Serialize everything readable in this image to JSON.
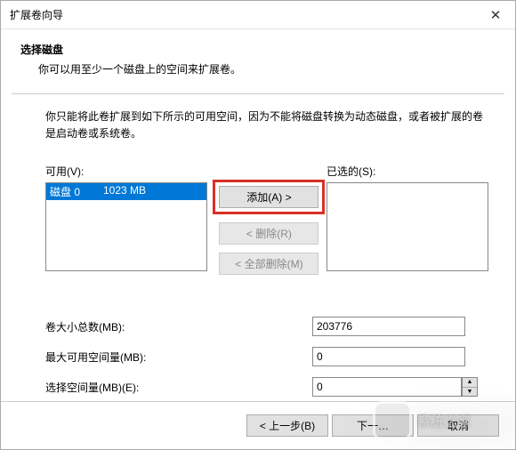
{
  "window": {
    "title": "扩展卷向导",
    "close_glyph": "✕"
  },
  "header": {
    "title": "选择磁盘",
    "subtitle": "你可以用至少一个磁盘上的空间来扩展卷。"
  },
  "intro": "你只能将此卷扩展到如下所示的可用空间，因为不能将磁盘转换为动态磁盘，或者被扩展的卷是启动卷或系统卷。",
  "labels": {
    "available": "可用(V):",
    "selected": "已选的(S):"
  },
  "available_items": [
    {
      "disk": "磁盘 0",
      "size": "1023 MB"
    }
  ],
  "buttons": {
    "add": "添加(A) >",
    "remove": "< 删除(R)",
    "remove_all": "< 全部删除(M)",
    "back": "< 上一步(B)",
    "next": "下一…",
    "cancel": "取消"
  },
  "form": {
    "total_label": "卷大小总数(MB):",
    "total_value": "203776",
    "max_label": "最大可用空间量(MB):",
    "max_value": "0",
    "select_label": "选择空间量(MB)(E):",
    "select_value": "0"
  },
  "watermark": {
    "text": "系统之家"
  }
}
